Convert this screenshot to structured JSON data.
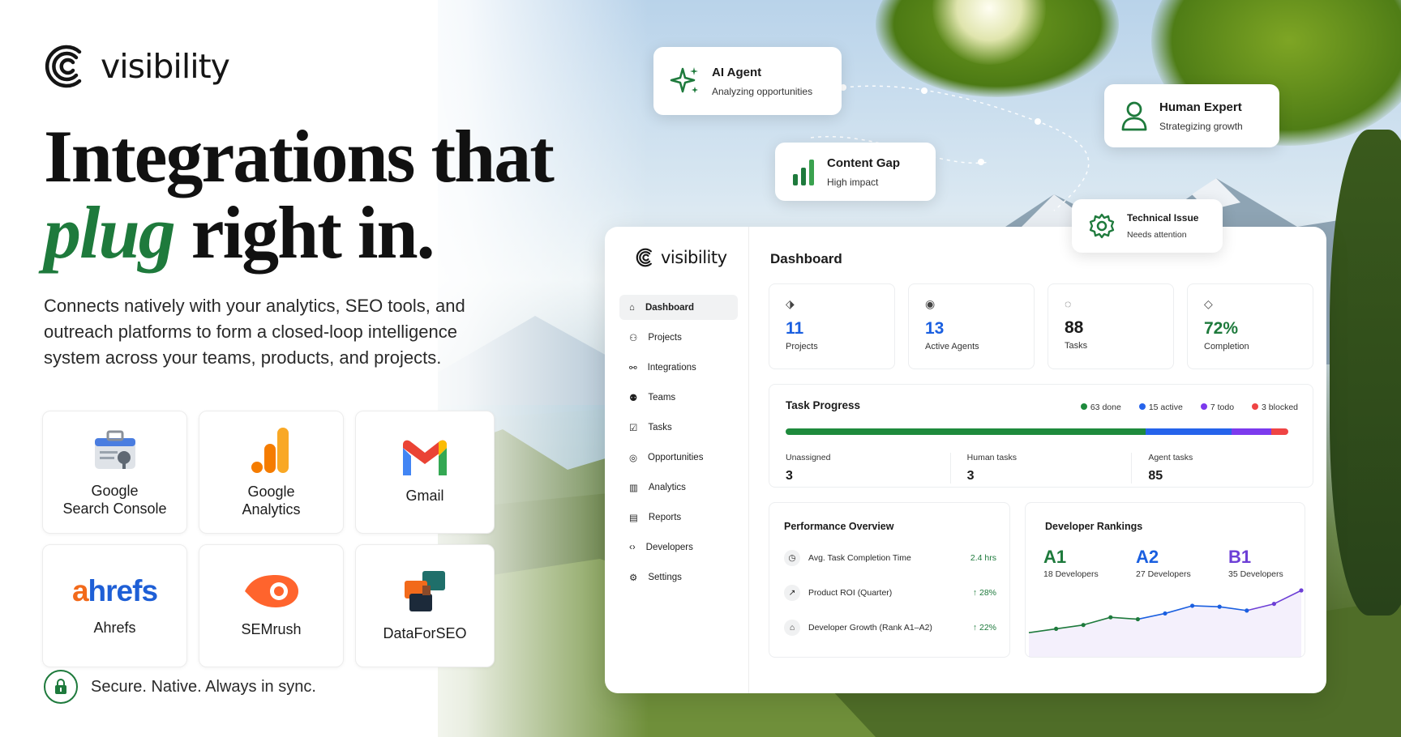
{
  "brand": {
    "name": "visibility"
  },
  "hero": {
    "line1": "Integrations that",
    "accent": "plug",
    "line2_rest": " right in.",
    "subtitle": "Connects natively with your analytics, SEO tools, and outreach platforms to form a closed-loop intelligence system across your teams, products, and projects."
  },
  "integrations": [
    {
      "label": "Google\nSearch Console",
      "icon": "search-console-icon"
    },
    {
      "label": "Google\nAnalytics",
      "icon": "analytics-icon"
    },
    {
      "label": "Gmail",
      "icon": "gmail-icon"
    },
    {
      "label": "Ahrefs",
      "logo": "ahrefs"
    },
    {
      "label": "SEMrush",
      "icon": "semrush-icon"
    },
    {
      "label": "DataForSEO",
      "icon": "dataforseo-icon"
    }
  ],
  "footer": {
    "secure_text": "Secure. Native. Always in sync."
  },
  "floating": {
    "ai_agent": {
      "title": "AI Agent",
      "status": "Analyzing opportunities"
    },
    "content_gap": {
      "title": "Content Gap",
      "status": "High impact"
    },
    "human_expert": {
      "title": "Human Expert",
      "status": "Strategizing growth"
    },
    "technical_issue": {
      "title": "Technical Issue",
      "status": "Needs attention"
    }
  },
  "dashboard": {
    "title": "Dashboard",
    "nav": [
      "Dashboard",
      "Projects",
      "Integrations",
      "Teams",
      "Tasks",
      "Opportunities",
      "Analytics",
      "Reports",
      "Developers",
      "Settings"
    ],
    "active_nav": "Dashboard",
    "stats": [
      {
        "value": "11",
        "label": "Projects",
        "color": "#1a5fe0"
      },
      {
        "value": "13",
        "label": "Active Agents",
        "color": "#1a5fe0"
      },
      {
        "value": "88",
        "label": "Tasks",
        "color": "#1b1b1b"
      },
      {
        "value": "72%",
        "label": "Completion",
        "color": "#1e7a3c"
      }
    ],
    "task_progress": {
      "title": "Task Progress",
      "legend": [
        {
          "label": "63 done",
          "count": 63,
          "color": "#1e8a3c"
        },
        {
          "label": "15 active",
          "count": 15,
          "color": "#2563eb"
        },
        {
          "label": "7 todo",
          "count": 7,
          "color": "#7c3aed"
        },
        {
          "label": "3 blocked",
          "count": 3,
          "color": "#ef4444"
        }
      ],
      "columns": [
        {
          "label": "Unassigned",
          "value": "3"
        },
        {
          "label": "Human tasks",
          "value": "3"
        },
        {
          "label": "Agent tasks",
          "value": "85"
        }
      ]
    },
    "performance": {
      "title": "Performance Overview",
      "rows": [
        {
          "label": "Avg. Task Completion Time",
          "value": "2.4 hrs"
        },
        {
          "label": "Product ROI (Quarter)",
          "value": "↑ 28%"
        },
        {
          "label": "Developer Growth (Rank A1–A2)",
          "value": "↑ 22%"
        }
      ]
    },
    "rankings": {
      "title": "Developer Rankings",
      "ranks": [
        {
          "rank": "A1",
          "count": "18 Developers",
          "color": "#1e7a3c"
        },
        {
          "rank": "A2",
          "count": "27 Developers",
          "color": "#1a5fe0"
        },
        {
          "rank": "B1",
          "count": "35 Developers",
          "color": "#6d3fd6"
        }
      ],
      "trend": [
        10,
        14,
        18,
        26,
        24,
        30,
        38,
        37,
        33,
        40,
        54
      ]
    }
  }
}
